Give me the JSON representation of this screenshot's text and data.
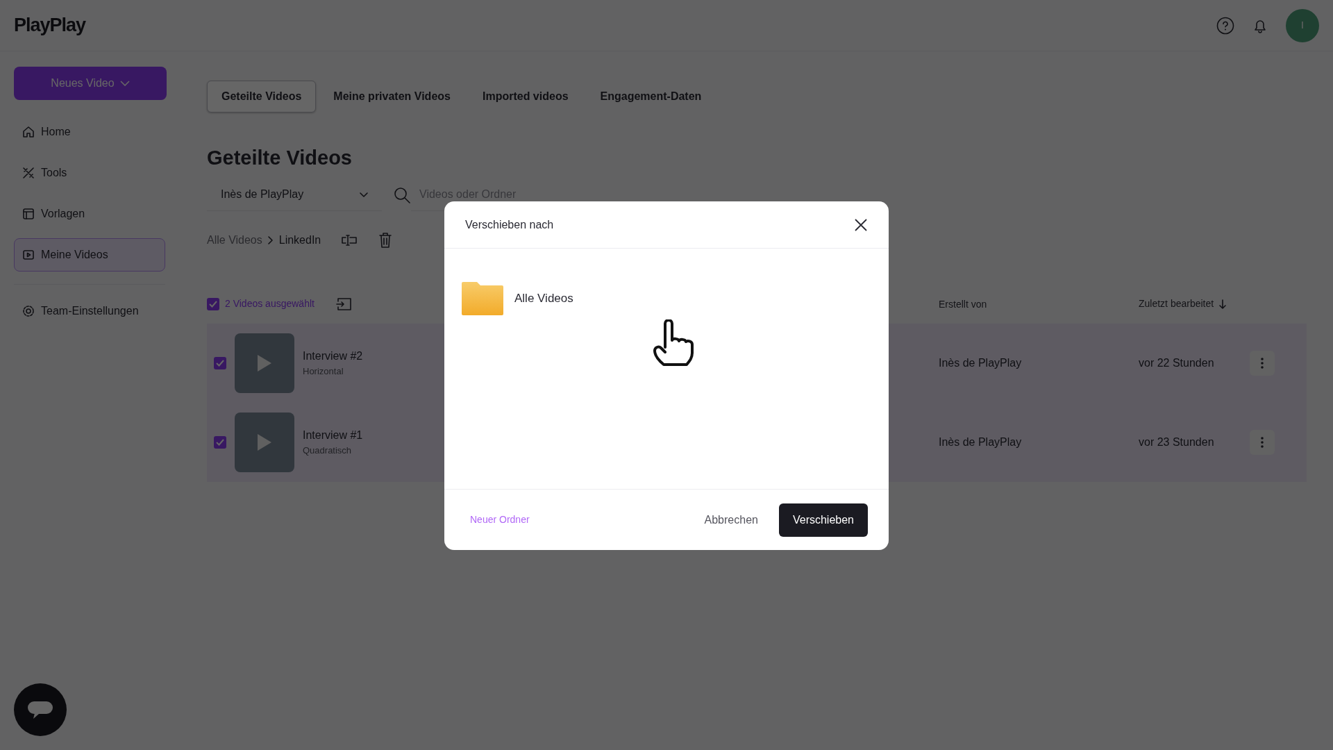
{
  "header": {
    "logo": "PlayPlay",
    "avatar_initial": "I"
  },
  "sidebar": {
    "new_button": "Neues Video",
    "items": [
      {
        "label": "Home",
        "selected": false
      },
      {
        "label": "Tools",
        "selected": false
      },
      {
        "label": "Vorlagen",
        "selected": false
      },
      {
        "label": "Meine Videos",
        "selected": true
      }
    ],
    "settings": "Team-Einstellungen"
  },
  "tabs": [
    {
      "label": "Geteilte Videos",
      "selected": true
    },
    {
      "label": "Meine privaten Videos",
      "selected": false
    },
    {
      "label": "Imported videos",
      "selected": false
    },
    {
      "label": "Engagement-Daten",
      "selected": false
    }
  ],
  "page_title": "Geteilte Videos",
  "filters": {
    "owner": "Inès de PlayPlay",
    "search_placeholder": "Videos oder Ordner"
  },
  "breadcrumb": [
    "Alle Videos",
    "LinkedIn"
  ],
  "table": {
    "selection": {
      "checked": true,
      "label": "2 Videos ausgewählt"
    },
    "columns": [
      "Erstellt von",
      "Zuletzt bearbeitet"
    ],
    "rows": [
      {
        "title": "Interview #2",
        "format": "Horizontal",
        "creator": "Inès de PlayPlay",
        "edited": "vor 22 Stunden",
        "checked": true
      },
      {
        "title": "Interview #1",
        "format": "Quadratisch",
        "creator": "Inès de PlayPlay",
        "edited": "vor 23 Stunden",
        "checked": true
      }
    ]
  },
  "dialog": {
    "title": "Verschieben nach",
    "folders": [
      {
        "name": "Alle Videos"
      }
    ],
    "new_folder": "Neuer Ordner",
    "cancel": "Abbrechen",
    "confirm": "Verschieben"
  }
}
